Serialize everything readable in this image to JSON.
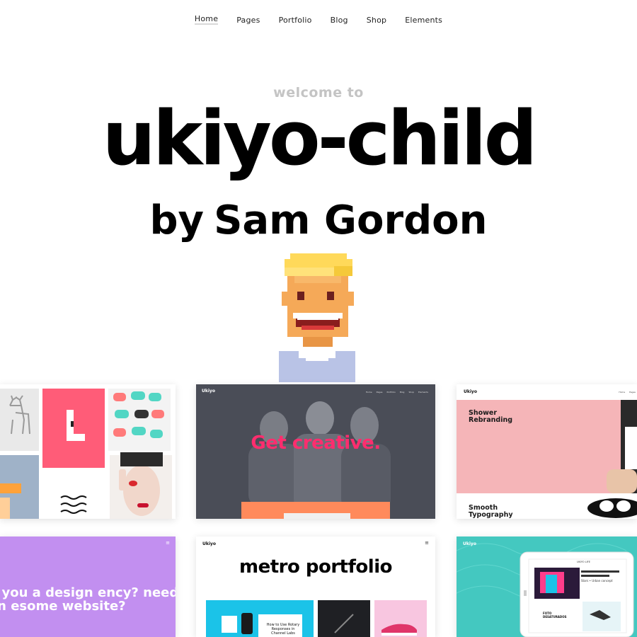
{
  "nav": {
    "items": [
      "Home",
      "Pages",
      "Portfolio",
      "Blog",
      "Shop",
      "Elements"
    ],
    "active": "Home"
  },
  "hero": {
    "welcome": "welcome to",
    "title": "ukiyo-child",
    "by": "by",
    "author": "Sam Gordon"
  },
  "avatar": {
    "icon": "pixel-avatar-icon"
  },
  "previews": {
    "creative": {
      "logo": "Ukiyo",
      "nav": [
        "Home",
        "Pages",
        "Portfolio",
        "Blog",
        "Shop",
        "Elements"
      ],
      "headline": "Get creative."
    },
    "shower": {
      "logo": "Ukiyo",
      "nav": [
        "Home",
        "Pages"
      ],
      "headline": "Shower Rebranding",
      "subline": "Smooth Typography"
    },
    "agency": {
      "headline": "e you a design ency? need an esome website?"
    },
    "metro": {
      "logo": "Ukiyo",
      "headline": "metro portfolio",
      "tile_title": "How to Use Rotary Responses in Channel Labs"
    },
    "tablet": {
      "logo": "Ukiyo",
      "device_header": "UKIYO LIFE",
      "slide_title": "Stars • Urban concept",
      "caption": "FOTO DESATURADOS"
    }
  },
  "colors": {
    "accent_pink": "#ff2d6e",
    "salmon": "#ff5c78",
    "lavender": "#c28ff0",
    "teal": "#44c8c0",
    "orange": "#ff8a5b",
    "blush": "#f5b5b8",
    "cyan": "#1bc3e8"
  }
}
